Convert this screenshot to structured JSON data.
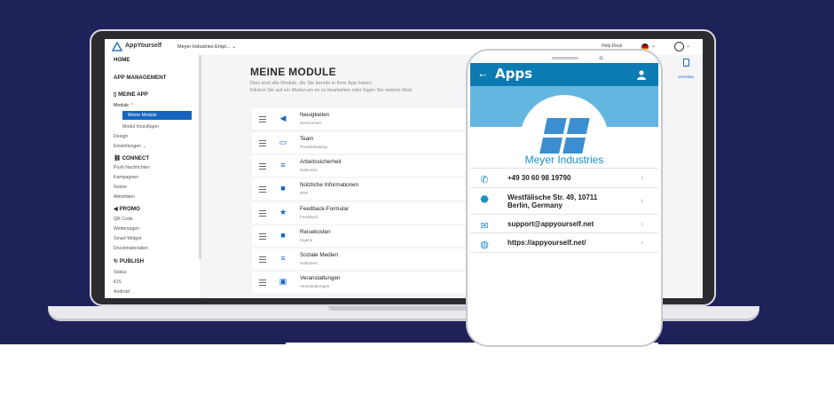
{
  "app": {
    "brand": "AppYourself",
    "project": "Meyer Industries Empl...",
    "help": "Help Desk",
    "preview_label": "Vorschau"
  },
  "sidebar": {
    "home": "HOME",
    "app_management": "APP MANAGEMENT",
    "my_app": {
      "title": "MEINE APP",
      "module": "Module",
      "items": [
        "Meine Module",
        "Modul hinzufügen"
      ],
      "design": "Design",
      "settings": "Einstellungen"
    },
    "connect": {
      "title": "CONNECT",
      "items": [
        "Push Nachrichten",
        "Kampagnen",
        "Nutzer",
        "Aktivitäten"
      ]
    },
    "promo": {
      "title": "PROMO",
      "items": [
        "QR Code",
        "Weitersagen",
        "Smart Widget",
        "Druckmaterialien"
      ]
    },
    "publish": {
      "title": "PUBLISH",
      "items": [
        "Status",
        "iOS",
        "Android"
      ]
    }
  },
  "main": {
    "title": "MEINE MODULE",
    "desc1": "Dies sind alle Module, die Sie bereits in Ihrer App haben.",
    "desc2": "Klicken Sie auf ein Modul um es zu bearbeiten oder fügen Sie weitere Mod",
    "modules": [
      {
        "title": "Neuigkeiten",
        "sub": "Newscenter",
        "icon": "megaphone-icon"
      },
      {
        "title": "Team",
        "sub": "Produktkatalog",
        "icon": "book-icon"
      },
      {
        "title": "Arbeitssicherheit",
        "sub": "Submenü",
        "icon": "lines-icon"
      },
      {
        "title": "Nützliche Informationen",
        "sub": "PDF",
        "icon": "document-icon"
      },
      {
        "title": "Feedback-Formular",
        "sub": "Feedback",
        "icon": "star-icon"
      },
      {
        "title": "Reisekosten",
        "sub": "Eigene",
        "icon": "document-icon"
      },
      {
        "title": "Soziale Medien",
        "sub": "Submenü",
        "icon": "lines-icon"
      },
      {
        "title": "Veranstaltungen",
        "sub": "Veranstaltungen",
        "icon": "calendar-icon"
      }
    ]
  },
  "phone": {
    "title": "Apps",
    "company": "Meyer Industries",
    "contacts": [
      {
        "icon": "phone-icon",
        "line1": "+49 30 60 98 19790",
        "line2": ""
      },
      {
        "icon": "location-icon",
        "line1": "Westfälische Str. 49, 10711",
        "line2": "Berlin, Germany"
      },
      {
        "icon": "mail-icon",
        "line1": "support@appyourself.net",
        "line2": ""
      },
      {
        "icon": "globe-icon",
        "line1": "https://appyourself.net/",
        "line2": ""
      }
    ]
  },
  "colors": {
    "navy": "#1f2159",
    "accent": "#1565c0",
    "phone_bar": "#0c7bb3",
    "banner": "#63b6e0"
  }
}
